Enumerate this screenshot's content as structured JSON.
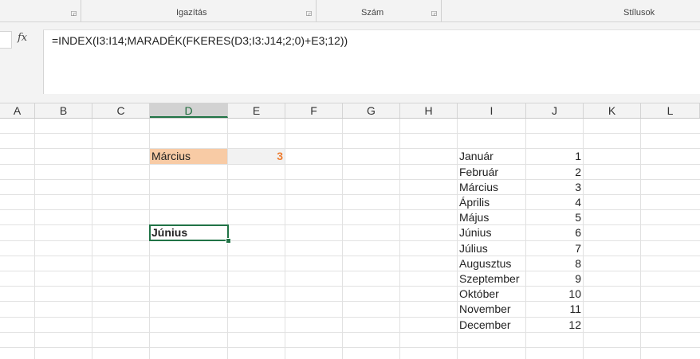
{
  "ribbon": {
    "groups": [
      {
        "label": ""
      },
      {
        "label": "Igazítás"
      },
      {
        "label": "Szám"
      },
      {
        "label": "Stílusok"
      }
    ]
  },
  "formula_bar": {
    "fx_label": "fx",
    "formula": "=INDEX(I3:I14;MARADÉK(FKERES(D3;I3:J14;2;0)+E3;12))"
  },
  "columns": [
    "A",
    "B",
    "C",
    "D",
    "E",
    "F",
    "G",
    "H",
    "I",
    "J",
    "K",
    "L"
  ],
  "active_column": "D",
  "cells": {
    "D3": "Március",
    "E3": "3",
    "D8": "Június"
  },
  "months_table": {
    "names": [
      "Január",
      "Február",
      "Március",
      "Április",
      "Május",
      "Június",
      "Július",
      "Augusztus",
      "Szeptember",
      "Október",
      "November",
      "December"
    ],
    "numbers": [
      "1",
      "2",
      "3",
      "4",
      "5",
      "6",
      "7",
      "8",
      "9",
      "10",
      "11",
      "12"
    ]
  },
  "colors": {
    "highlight_fill": "#f8cba5",
    "accent_number": "#ed7d31",
    "selection": "#217346"
  }
}
